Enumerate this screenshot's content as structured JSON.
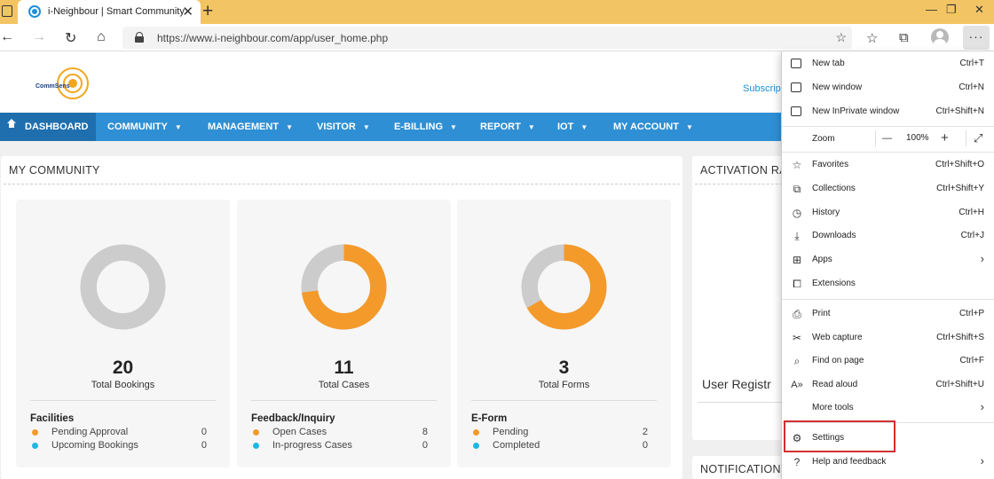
{
  "browser": {
    "tab_title": "i-Neighbour | Smart Community",
    "url": "https://www.i-neighbour.com/app/user_home.php"
  },
  "site": {
    "logo_text": "CommSens",
    "subscribe": "Subscrip",
    "nav": [
      {
        "label": "DASHBOARD"
      },
      {
        "label": "COMMUNITY"
      },
      {
        "label": "MANAGEMENT"
      },
      {
        "label": "VISITOR"
      },
      {
        "label": "E-BILLING"
      },
      {
        "label": "REPORT"
      },
      {
        "label": "IOT"
      },
      {
        "label": "MY ACCOUNT"
      }
    ]
  },
  "my_community": {
    "title": "MY COMMUNITY",
    "cards": [
      {
        "value": 20,
        "label": "Total Bookings",
        "category": "Facilities",
        "fraction": 0,
        "rows": [
          {
            "label": "Pending Approval",
            "value": 0,
            "color": "#f39a2b"
          },
          {
            "label": "Upcoming Bookings",
            "value": 0,
            "color": "#1fb6e0"
          }
        ]
      },
      {
        "value": 11,
        "label": "Total Cases",
        "category": "Feedback/Inquiry",
        "fraction": 0.7273,
        "rows": [
          {
            "label": "Open Cases",
            "value": 8,
            "color": "#f39a2b"
          },
          {
            "label": "In-progress Cases",
            "value": 0,
            "color": "#1fb6e0"
          }
        ]
      },
      {
        "value": 3,
        "label": "Total Forms",
        "category": "E-Form",
        "fraction": 0.6667,
        "rows": [
          {
            "label": "Pending",
            "value": 2,
            "color": "#f39a2b"
          },
          {
            "label": "Completed",
            "value": 0,
            "color": "#1fb6e0"
          }
        ]
      }
    ]
  },
  "activation": {
    "title": "ACTIVATION RA",
    "user_reg": "User Registr"
  },
  "notification": {
    "title": "NOTIFICATION"
  },
  "colors": {
    "accent": "#f39a2b",
    "track": "#cccccc",
    "nav": "#2f8fd4",
    "highlight": "#d32f2f"
  },
  "menu": {
    "new_tab": {
      "label": "New tab",
      "shortcut": "Ctrl+T"
    },
    "new_window": {
      "label": "New window",
      "shortcut": "Ctrl+N"
    },
    "new_private": {
      "label": "New InPrivate window",
      "shortcut": "Ctrl+Shift+N"
    },
    "zoom": {
      "label": "Zoom",
      "minus": "—",
      "value": "100%",
      "plus": "+"
    },
    "favorites": {
      "label": "Favorites",
      "shortcut": "Ctrl+Shift+O"
    },
    "collections": {
      "label": "Collections",
      "shortcut": "Ctrl+Shift+Y"
    },
    "history": {
      "label": "History",
      "shortcut": "Ctrl+H"
    },
    "downloads": {
      "label": "Downloads",
      "shortcut": "Ctrl+J"
    },
    "apps": {
      "label": "Apps"
    },
    "extensions": {
      "label": "Extensions"
    },
    "print": {
      "label": "Print",
      "shortcut": "Ctrl+P"
    },
    "web_capture": {
      "label": "Web capture",
      "shortcut": "Ctrl+Shift+S"
    },
    "find": {
      "label": "Find on page",
      "shortcut": "Ctrl+F"
    },
    "read_aloud": {
      "label": "Read aloud",
      "shortcut": "Ctrl+Shift+U"
    },
    "more_tools": {
      "label": "More tools"
    },
    "settings": {
      "label": "Settings"
    },
    "help": {
      "label": "Help and feedback"
    }
  }
}
